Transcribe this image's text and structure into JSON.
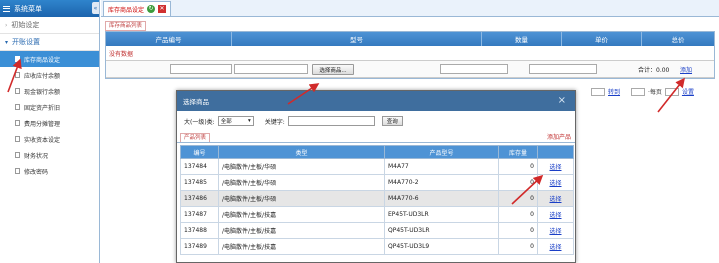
{
  "sidebar": {
    "title": "系统菜单",
    "collapse_glyph": "«",
    "groups": [
      {
        "label": "初始设定",
        "arrow": "›"
      },
      {
        "label": "开账设置",
        "arrow": "▾"
      }
    ],
    "items": [
      {
        "label": "库存商品设定"
      },
      {
        "label": "应收应付余额"
      },
      {
        "label": "现金银行余额"
      },
      {
        "label": "固定资产折旧"
      },
      {
        "label": "费用分摊管理"
      },
      {
        "label": "实收资本设定"
      },
      {
        "label": "财务状况"
      },
      {
        "label": "修改密码"
      }
    ]
  },
  "tab": {
    "label": "库存商品设定",
    "refresh_glyph": "↻",
    "close_glyph": "✕"
  },
  "list": {
    "section_label": "库存商品列表",
    "columns": [
      "产品编号",
      "型号",
      "数量",
      "单价",
      "总价"
    ],
    "empty_text": "没有数据",
    "select_button": "选择商品...",
    "total_label": "合计：0.00",
    "add_link": "添加"
  },
  "pager": {
    "goto_link": "转到",
    "per_page": "·每页",
    "set_link": "设置"
  },
  "modal": {
    "title": "选择商品",
    "close_glyph": "×",
    "category_label": "大(一级)类:",
    "category_value": "全部",
    "keyword_label": "关键字:",
    "query_button": "查询",
    "list_tab": "产品列表",
    "add_product_link": "添加产品",
    "columns": [
      "编号",
      "类型",
      "产品型号",
      "库存量",
      ""
    ],
    "rows": [
      {
        "id": "137484",
        "type": "/电脑散件/主板/华硕",
        "model": "M4A77",
        "stock": "0",
        "action": "选择"
      },
      {
        "id": "137485",
        "type": "/电脑散件/主板/华硕",
        "model": "M4A770-2",
        "stock": "0",
        "action": "选择"
      },
      {
        "id": "137486",
        "type": "/电脑散件/主板/华硕",
        "model": "M4A770-6",
        "stock": "0",
        "action": "选择"
      },
      {
        "id": "137487",
        "type": "/电脑散件/主板/技嘉",
        "model": "EP45T-UD3LR",
        "stock": "0",
        "action": "选择"
      },
      {
        "id": "137488",
        "type": "/电脑散件/主板/技嘉",
        "model": "QP45T-UD3LR",
        "stock": "0",
        "action": "选择"
      },
      {
        "id": "137489",
        "type": "/电脑散件/主板/技嘉",
        "model": "QP45T-UD3L9",
        "stock": "0",
        "action": "选择"
      }
    ]
  },
  "colors": {
    "accent": "#3b8fd6",
    "header": "#3479bf",
    "annotation": "#d12a2a",
    "link": "#1a3fc7"
  }
}
